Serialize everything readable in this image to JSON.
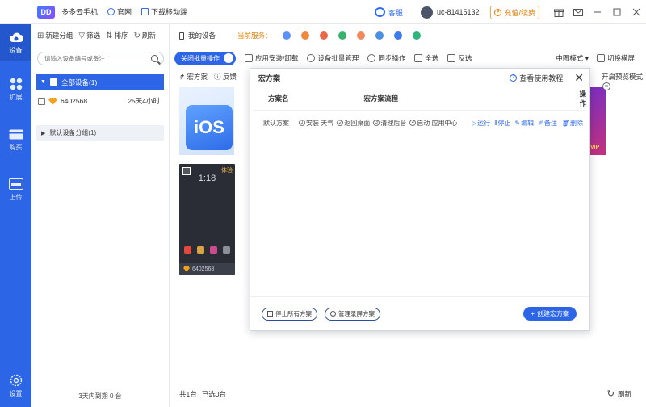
{
  "titlebar": {
    "logo": "DD",
    "app_name": "多多云手机",
    "website": "官网",
    "download_mobile": "下载移动端",
    "support": "客服",
    "user_id": "uc-81415132",
    "recharge": "充值/续费",
    "gift_icon": "gift-icon",
    "mail_icon": "mail-icon"
  },
  "nav": [
    {
      "label": "设备",
      "icon": "cloud-icon",
      "active": true
    },
    {
      "label": "扩展",
      "icon": "grid-icon",
      "active": false
    },
    {
      "label": "购买",
      "icon": "card-icon",
      "active": false
    },
    {
      "label": "上传",
      "icon": "file-icon",
      "active": false
    },
    {
      "label": "设置",
      "icon": "gear-icon",
      "active": false
    }
  ],
  "devices_panel": {
    "new_group": "新建分组",
    "filter": "筛选",
    "sort": "排序",
    "refresh": "刷新",
    "search_placeholder": "请输入设备编号或备注",
    "all_devices": "全部设备(1)",
    "device": {
      "id": "6402568",
      "remaining": "25天4小时"
    },
    "default_group": "默认设备分组(1)",
    "footer": "3天内到期 0 台"
  },
  "main": {
    "my_devices": "我的设备",
    "current_services": "当前服务：",
    "batch_toggle": "关闭批量操作",
    "app_install": "应用安装/卸载",
    "batch_manage": "设备批量管理",
    "sync": "同步操作",
    "select_all": "全选",
    "invert": "反选",
    "view_mode": "中图模式",
    "switch_orientation": "切换横屏",
    "macro": "宏方案",
    "feedback": "反馈",
    "preview_mode": "开启预览模式",
    "ios_label": "iOS",
    "phone_time": "1:18",
    "phone_tag": "体验",
    "phone_id": "6402568",
    "promo_text": "VIP",
    "total": "共1台",
    "selected": "已选0台",
    "refresh": "刷新"
  },
  "dialog": {
    "title": "宏方案",
    "help": "查看使用教程",
    "columns": [
      "方案名",
      "宏方案流程",
      "操作"
    ],
    "rows": [
      {
        "name": "默认方案",
        "steps": [
          {
            "num": "1",
            "label": "安装 天气"
          },
          {
            "num": "2",
            "label": "返回桌面"
          },
          {
            "num": "3",
            "label": "清理后台"
          },
          {
            "num": "4",
            "label": "启动 应用中心"
          }
        ],
        "ops": [
          "运行",
          "停止",
          "编辑",
          "备注",
          "删除"
        ]
      }
    ],
    "stop_all": "停止所有方案",
    "manage_recordings": "管理录屏方案",
    "create": "创建宏方案"
  }
}
